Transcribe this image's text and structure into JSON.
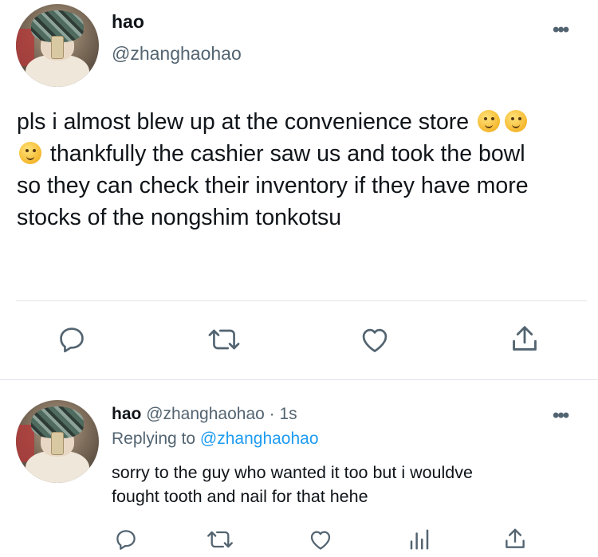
{
  "main_tweet": {
    "display_name": "hao",
    "handle": "@zhanghaohao",
    "more_icon": "more-horizontal-icon",
    "text_lines": [
      "pls i almost blew up at the convenience store",
      "thankfully the cashier saw us and took the bowl",
      "so they can check their inventory if they have more",
      "stocks of the nongshim tonkotsu"
    ],
    "emoji": "melting-face-emoji",
    "actions": [
      "reply-icon",
      "retweet-icon",
      "like-icon",
      "share-icon"
    ]
  },
  "reply_tweet": {
    "display_name": "hao",
    "handle": "@zhanghaohao",
    "separator": "·",
    "time": "1s",
    "replying_prefix": "Replying to",
    "replying_handle": "@zhanghaohao",
    "text_line1": "sorry to the guy who wanted it too but i wouldve",
    "text_line2": "fought tooth and nail for that hehe",
    "actions": [
      "reply-icon",
      "retweet-icon",
      "like-icon",
      "analytics-icon",
      "share-icon"
    ]
  },
  "colors": {
    "text": "#0f1419",
    "secondary": "#536471",
    "link": "#1d9bf0",
    "divider": "#e1e6ea"
  }
}
